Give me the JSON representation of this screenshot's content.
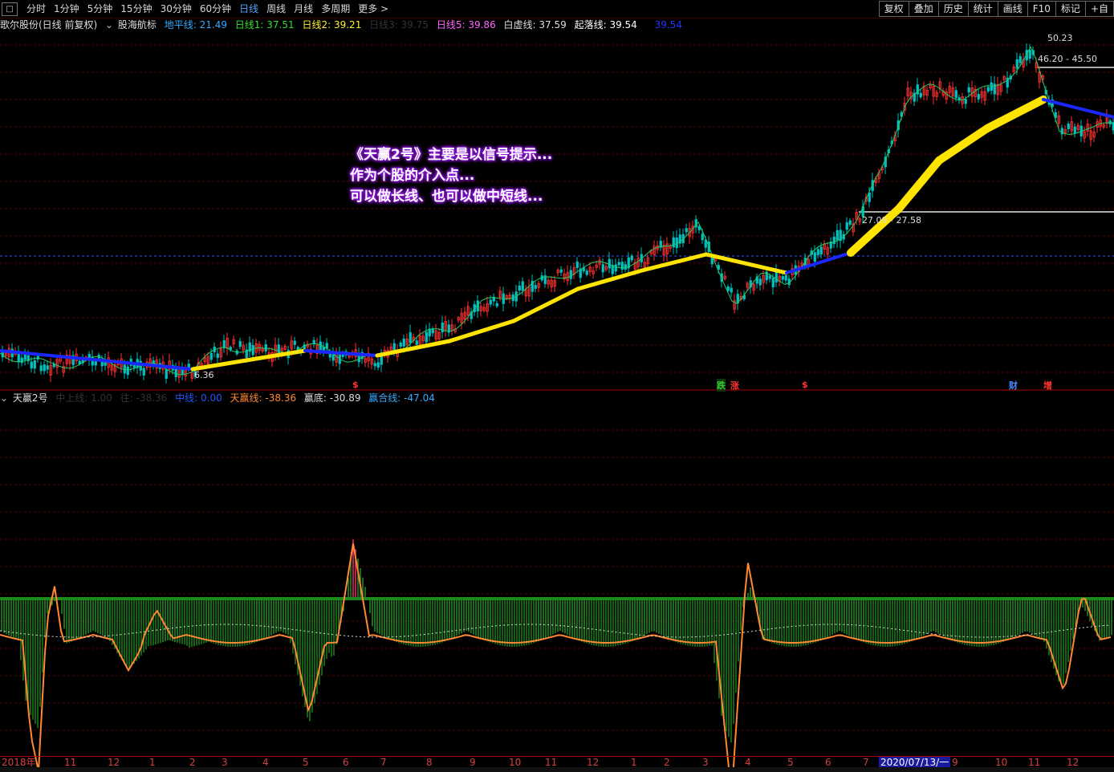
{
  "toolbar": {
    "left_button": "□",
    "periods": [
      "分时",
      "1分钟",
      "5分钟",
      "15分钟",
      "30分钟",
      "60分钟",
      "日线",
      "周线",
      "月线",
      "多周期",
      "更多 >"
    ],
    "active_period": "日线",
    "right_buttons": [
      "复权",
      "叠加",
      "历史",
      "统计",
      "画线",
      "F10",
      "标记",
      "+自"
    ]
  },
  "main_info": {
    "stock": "歌尔股份(日线 前复权)",
    "indicator": "股海航标",
    "items": [
      {
        "label": "地平线: 21.49",
        "color": "#33aaff"
      },
      {
        "label": "日线1: 37.51",
        "color": "#33dd33"
      },
      {
        "label": "日线2: 39.21",
        "color": "#ffee33"
      },
      {
        "label": "日线3: 39.75",
        "color": "#333333"
      },
      {
        "label": "日线5: 39.86",
        "color": "#ff66ff"
      },
      {
        "label": "白虚线: 37.59",
        "color": "#dddddd"
      },
      {
        "label": "起落线: 39.54",
        "color": "#ffffff"
      },
      {
        "label": "39.54",
        "color": "#2233ff"
      }
    ]
  },
  "annotation": {
    "line1": "《天赢2号》主要是以信号提示...",
    "line2": "作为个股的介入点...",
    "line3": "可以做长线、也可以做中短线..."
  },
  "price_labels": {
    "high": "50.23",
    "range_top": "46.20 - 45.50",
    "range_mid": "27.09 - 27.58",
    "low": "6.36"
  },
  "signals": [
    {
      "text": "$",
      "color": "#ff3333"
    },
    {
      "text": "跌",
      "color": "#33cc33"
    },
    {
      "text": "涨",
      "color": "#ff3333"
    },
    {
      "text": "$",
      "color": "#ff3333"
    },
    {
      "text": "财",
      "color": "#4488ff"
    },
    {
      "text": "增",
      "color": "#ff3333"
    }
  ],
  "sub_info": {
    "name": "天赢2号",
    "items": [
      {
        "label": "中上线: 1.00",
        "color": "#333333"
      },
      {
        "label": "往: -38.36",
        "color": "#333333"
      },
      {
        "label": "中线: 0.00",
        "color": "#2255ff"
      },
      {
        "label": "天赢线: -38.36",
        "color": "#ff8833"
      },
      {
        "label": "赢底: -30.89",
        "color": "#dddddd"
      },
      {
        "label": "赢合线: -47.04",
        "color": "#33aaff"
      }
    ]
  },
  "x_axis": {
    "labels": [
      "2018年",
      "11",
      "12",
      "1",
      "2",
      "3",
      "4",
      "5",
      "6",
      "7",
      "8",
      "9",
      "10",
      "11",
      "12",
      "1",
      "2",
      "3",
      "4",
      "5",
      "6",
      "7",
      "2020/07/13/一",
      "9",
      "10",
      "11",
      "12"
    ]
  },
  "colors": {
    "grid": "#5a0000",
    "up": "#ff3030",
    "down": "#00c0c0"
  }
}
